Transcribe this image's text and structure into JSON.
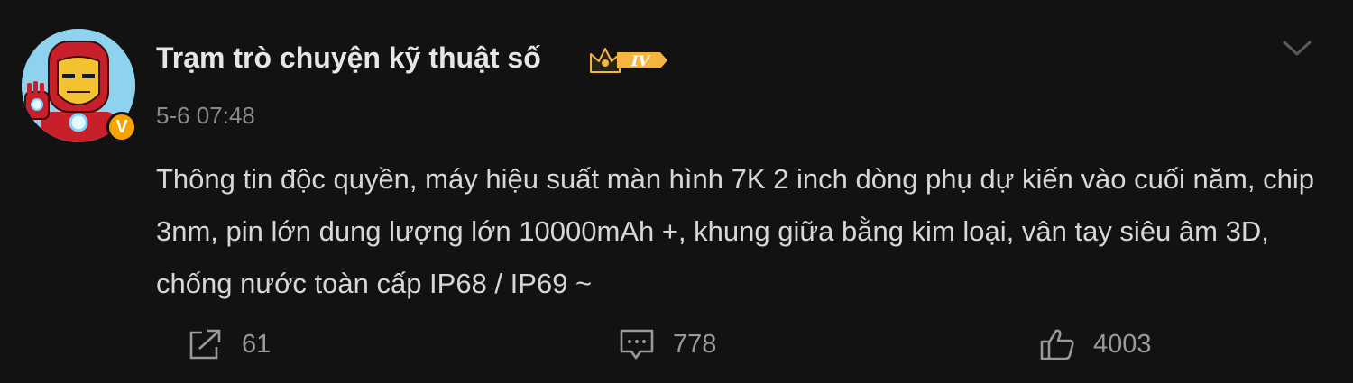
{
  "post": {
    "author": {
      "name": "Trạm trò chuyện kỹ thuật số",
      "level_badge": "IV",
      "verified_mark": "V"
    },
    "timestamp": "5-6 07:48",
    "text": "Thông tin độc quyền, máy hiệu suất màn hình 7K 2 inch dòng phụ dự kiến vào cuối năm, chip 3nm, pin lớn dung lượng lớn 10000mAh +, khung giữa bằng kim loại, vân tay siêu âm 3D, chống nước toàn cấp IP68 / IP69 ~"
  },
  "actions": {
    "share": {
      "icon": "share-icon",
      "count": "61"
    },
    "comment": {
      "icon": "comment-icon",
      "count": "778"
    },
    "like": {
      "icon": "thumbs-up-icon",
      "count": "4003"
    }
  },
  "colors": {
    "background": "#121212",
    "text": "#d7d7d7",
    "muted": "#8a8a8a",
    "verified": "#f7a400",
    "badge_gold": "#f5b540"
  }
}
